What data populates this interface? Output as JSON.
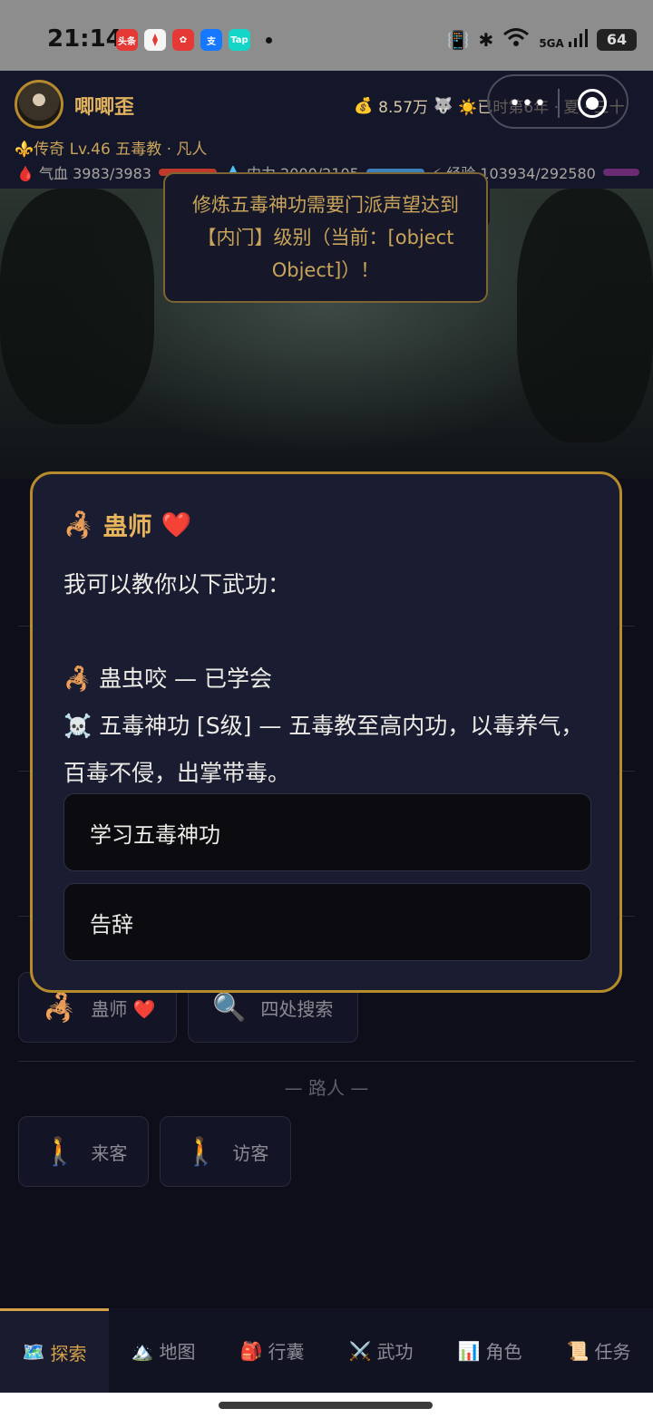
{
  "status_bar": {
    "time": "21:14",
    "apps": [
      {
        "label": "头条",
        "color": "#e53935"
      },
      {
        "label": "",
        "color": "#f5f5f5"
      },
      {
        "label": "",
        "color": "#e53935"
      },
      {
        "label": "支",
        "color": "#1677ff"
      },
      {
        "label": "Tap",
        "color": "#14d6c8"
      }
    ],
    "network": "5GA",
    "battery": "64"
  },
  "header": {
    "player_name": "唧唧歪",
    "money": "8.57万",
    "time_text": "☀️已时第6年 · 夏 · 三十",
    "rank_line": "⚜️传奇 Lv.46 五毒教 · 凡人",
    "hp": "🩸 气血 3983/3983",
    "mp": "💧 内力 2000/2105",
    "exp": "⚡ 经验 103934/292580"
  },
  "toast": {
    "text": "修炼五毒神功需要门派声望达到【内门】级别（当前：[object Object]）！"
  },
  "modal": {
    "npc_icon": "🦂",
    "npc_name": "蛊师",
    "npc_heart": "❤️",
    "intro": "我可以教你以下武功：",
    "skill1": "🦂 蛊虫咬 — 已学会",
    "skill2": "☠️ 五毒神功 [S级] — 五毒教至高内功，以毒养气，百毒不侵，出掌带毒。",
    "btn_learn": "学习五毒神功",
    "btn_leave": "告辞"
  },
  "underlay": {
    "chips": [
      {
        "emoji": "🦂",
        "label": "蛊师 ❤️"
      },
      {
        "emoji": "🔍",
        "label": "四处搜索"
      }
    ],
    "passerby_title": "— 路人 —",
    "passersby": [
      {
        "emoji": "🚶",
        "label": "来客"
      },
      {
        "emoji": "🚶",
        "label": "访客"
      }
    ]
  },
  "bottom_nav": [
    {
      "icon": "🗺️",
      "label": "探索"
    },
    {
      "icon": "🏔️",
      "label": "地图"
    },
    {
      "icon": "🎒",
      "label": "行囊"
    },
    {
      "icon": "⚔️",
      "label": "武功"
    },
    {
      "icon": "📊",
      "label": "角色"
    },
    {
      "icon": "📜",
      "label": "任务"
    }
  ]
}
